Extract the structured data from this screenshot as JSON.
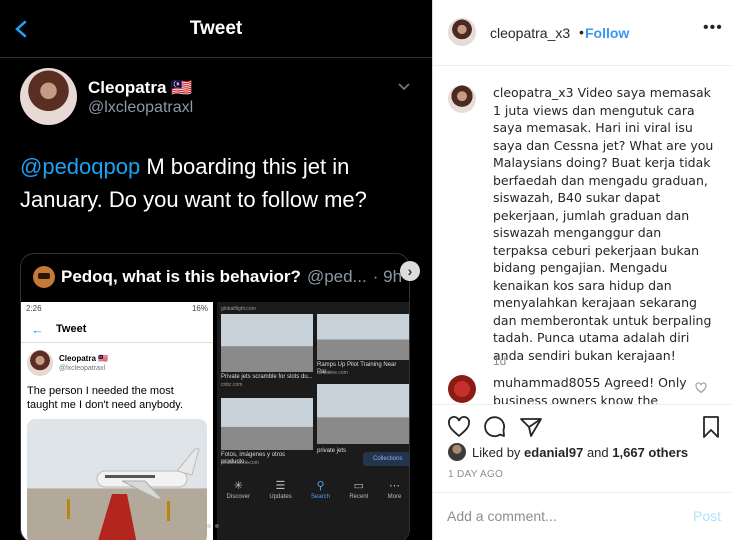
{
  "tweet": {
    "header_title": "Tweet",
    "author_name": "Cleopatra 🇲🇾",
    "author_handle": "@lxcleopatraxl",
    "mention": "@pedoqpop",
    "text": " M boarding this jet in January. Do you want to follow me?",
    "quote": {
      "name": "Pedoq, what is this behavior?",
      "handle": "@ped...",
      "time": "· 9h",
      "phone_left": {
        "status_time": "2:26",
        "status_battery": "16%",
        "header_title": "Tweet",
        "author_name": "Cleopatra 🇲🇾",
        "author_handle": "@lxcleopatraxl",
        "text": "The person I needed the most taught me I don't need anybody."
      },
      "phone_right": {
        "source_top": "globalflight.com",
        "results": [
          {
            "title": "Private jets scramble for slots du...",
            "source": "cnbc.com"
          },
          {
            "title": "Ramps Up Pilot Training Near Par...",
            "source": "ainonline.com"
          },
          {
            "title": "Fotos, imágenes y otros producto...",
            "source": "shutterstock.com"
          },
          {
            "title": "private jets",
            "source": ""
          }
        ],
        "collections_label": "Collections",
        "nav": [
          {
            "label": "Discover",
            "icon": "✳"
          },
          {
            "label": "Updates",
            "icon": "☰"
          },
          {
            "label": "Search",
            "icon": "⚲"
          },
          {
            "label": "Recent",
            "icon": "▭"
          },
          {
            "label": "More",
            "icon": "⋯"
          }
        ]
      }
    }
  },
  "instagram": {
    "username": "cleopatra_x3",
    "dot": "•",
    "follow_label": "Follow",
    "more_icon": "•••",
    "caption_user": "cleopatra_x3",
    "caption": " Video saya memasak 1 juta views dan mengutuk cara saya memasak. Hari ini viral isu saya dan Cessna jet? What are you Malaysians doing? Buat kerja tidak berfaedah dan mengadu graduan, siswazah, B40 sukar dapat pekerjaan, jumlah graduan dan siswazah menganggur dan terpaksa ceburi pekerjaan bukan bidang pengajian. Mengadu kenaikan kos sara hidup dan menyalahkan kerajaan sekarang dan memberontak untuk berpaling tadah. Punca utama adalah diri anda sendiri bukan kerajaan!",
    "caption_age": "1d",
    "comment_user": "muhammad8055",
    "comment_text": " Agreed! Only business owners know the",
    "likes_prefix": "Liked by ",
    "likes_user": "edanial97",
    "likes_suffix": " and ",
    "likes_count": "1,667 others",
    "date": "1 DAY AGO",
    "add_comment_placeholder": "Add a comment...",
    "post_label": "Post"
  },
  "colors": {
    "twitter_blue": "#1da1f2",
    "instagram_blue": "#3897f0",
    "post_disabled": "#b2dffc"
  }
}
